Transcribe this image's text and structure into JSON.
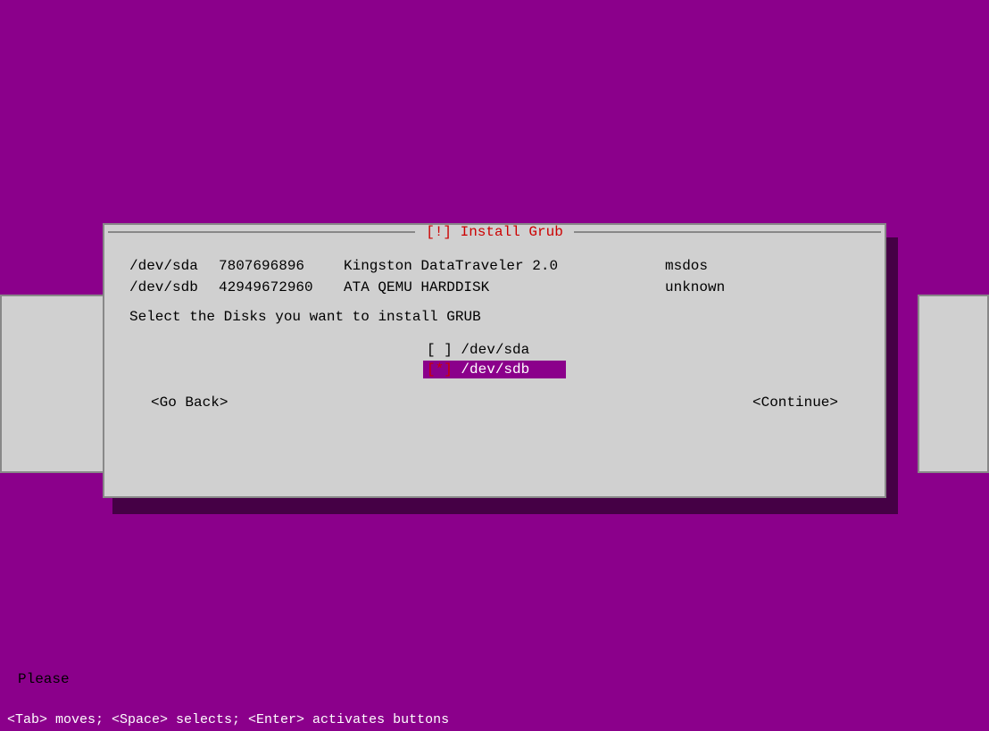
{
  "background_color": "#8B008B",
  "dialog": {
    "title": "[!] Install Grub",
    "disks": [
      {
        "device": "/dev/sda",
        "size": "7807696896",
        "name": "Kingston DataTraveler 2.0",
        "type": "msdos"
      },
      {
        "device": "/dev/sdb",
        "size": "42949672960",
        "name": "ATA QEMU HARDDISK",
        "type": "unknown"
      }
    ],
    "prompt": "Select the Disks you want to install GRUB",
    "options": [
      {
        "id": "sda",
        "label": "/dev/sda",
        "checked": false,
        "marker_unchecked": "[ ]",
        "marker_checked": "[*]"
      },
      {
        "id": "sdb",
        "label": "/dev/sdb",
        "checked": true,
        "marker_unchecked": "[ ]",
        "marker_checked": "[*]"
      }
    ],
    "buttons": {
      "back": "<Go Back>",
      "continue": "<Continue>"
    }
  },
  "bg_partial": {
    "text": "Please"
  },
  "status_bar": "<Tab> moves; <Space> selects; <Enter> activates buttons"
}
